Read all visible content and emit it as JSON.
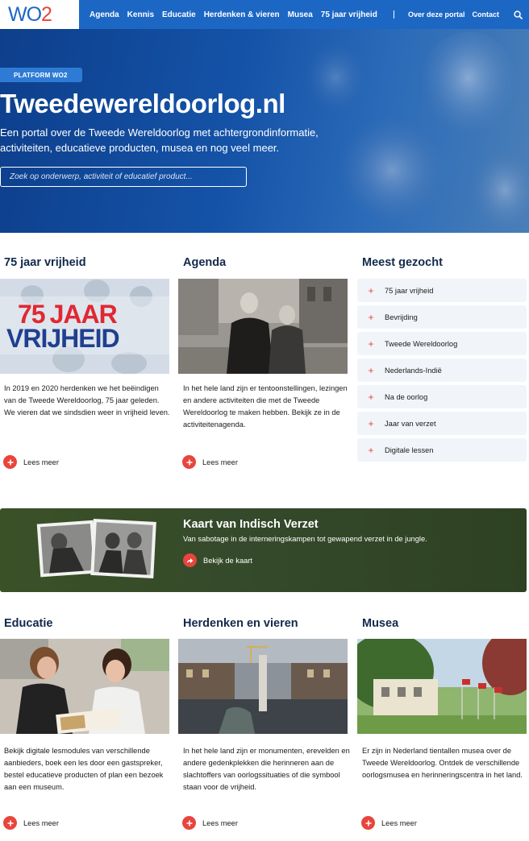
{
  "nav": {
    "logo_wo": "WO",
    "logo_2": "2",
    "links": [
      "Agenda",
      "Kennis",
      "Educatie",
      "Herdenken & vieren",
      "Musea",
      "75 jaar vrijheid"
    ],
    "right_links": [
      "Over deze portal",
      "Contact"
    ]
  },
  "hero": {
    "badge": "PLATFORM WO2",
    "title": "Tweedewereldoorlog.nl",
    "subtitle": "Een portal over de Tweede Wereldoorlog met achtergrondinformatie, activiteiten, educatieve producten, musea en nog veel meer.",
    "search_placeholder": "Zoek op onderwerp, activiteit of educatief product..."
  },
  "row1": {
    "col1": {
      "title": "75 jaar vrijheid",
      "img_line1_num": "75",
      "img_line1_word": "JAAR",
      "img_line2": "VRIJHEID",
      "text": "In 2019 en 2020 herdenken we het beëindigen van de Tweede Wereldoorlog, 75 jaar geleden. We vieren dat we sindsdien weer in vrijheid leven.",
      "more": "Lees meer"
    },
    "col2": {
      "title": "Agenda",
      "text": "In het hele land zijn er tentoonstellingen, lezingen en andere activiteiten die met de Tweede Wereldoorlog te maken hebben. Bekijk ze in de activiteitenagenda.",
      "more": "Lees meer"
    },
    "col3": {
      "title": "Meest gezocht",
      "items": [
        "75 jaar vrijheid",
        "Bevrijding",
        "Tweede Wereldoorlog",
        "Nederlands-Indië",
        "Na de oorlog",
        "Jaar van verzet",
        "Digitale lessen"
      ]
    }
  },
  "banner": {
    "title": "Kaart van Indisch Verzet",
    "subtitle": "Van sabotage in de interneringskampen tot gewapend verzet in de jungle.",
    "link": "Bekijk de kaart"
  },
  "row2": {
    "col1": {
      "title": "Educatie",
      "text": "Bekijk digitale lesmodules van verschillende aanbieders, boek een les door een gastspreker, bestel educatieve producten of plan een bezoek aan een museum.",
      "more": "Lees meer"
    },
    "col2": {
      "title": "Herdenken en vieren",
      "text": "In het hele land zijn er monumenten, erevelden en andere gedenkplekken die herinneren aan de slachtoffers van oorlogssituaties of die symbool staan voor de vrijheid.",
      "more": "Lees meer"
    },
    "col3": {
      "title": "Musea",
      "text": "Er zijn in Nederland tientallen musea over de Tweede Wereldoorlog. Ontdek de verschillende oorlogsmusea en herinneringscentra in het land.",
      "more": "Lees meer"
    }
  },
  "colors": {
    "brand_blue": "#1d67c4",
    "accent_red": "#e8453c",
    "title_navy": "#13294b",
    "banner_green": "#34492a"
  },
  "icons": {
    "search": "search-icon",
    "plus": "plus-icon",
    "share": "share-arrow-icon"
  }
}
